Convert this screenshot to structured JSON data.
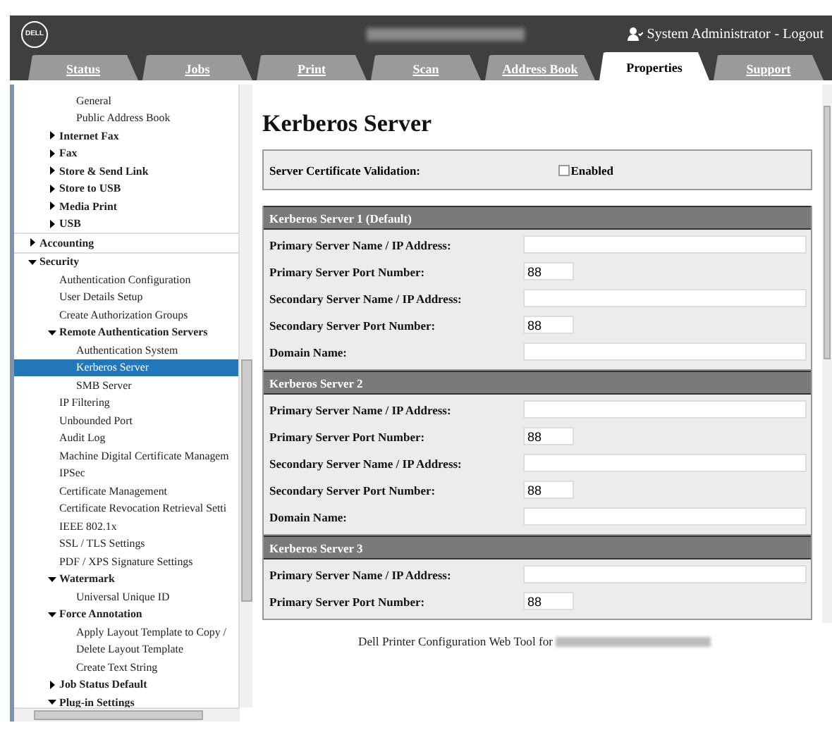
{
  "header": {
    "logo": "DELL",
    "user": "System Administrator",
    "logout": "- Logout"
  },
  "tabs": [
    {
      "label": "Status",
      "selected": false
    },
    {
      "label": "Jobs",
      "selected": false
    },
    {
      "label": "Print",
      "selected": false
    },
    {
      "label": "Scan",
      "selected": false
    },
    {
      "label": "Address Book",
      "selected": false
    },
    {
      "label": "Properties",
      "selected": true
    },
    {
      "label": "Support",
      "selected": false
    }
  ],
  "sidebar": {
    "items": [
      {
        "children": [
          {
            "children": [
              {
                "label": "General",
                "selected": false
              },
              {
                "label": "Public Address Book",
                "selected": false
              }
            ]
          },
          {
            "label": "Internet Fax",
            "expanded": false,
            "selected": false
          },
          {
            "label": "Fax",
            "expanded": false,
            "selected": false
          },
          {
            "label": "Store & Send Link",
            "expanded": false,
            "selected": false
          },
          {
            "label": "Store to USB",
            "expanded": false,
            "selected": false
          },
          {
            "label": "Media Print",
            "expanded": false,
            "selected": false
          },
          {
            "label": "USB",
            "expanded": false,
            "selected": false
          }
        ]
      },
      {
        "label": "Accounting",
        "expanded": false,
        "selected": false
      },
      {
        "label": "Security",
        "expanded": true,
        "selected": false,
        "children": [
          {
            "label": "Authentication Configuration",
            "selected": false
          },
          {
            "label": "User Details Setup",
            "selected": false
          },
          {
            "label": "Create Authorization Groups",
            "selected": false
          },
          {
            "label": "Remote Authentication Servers",
            "expanded": true,
            "selected": false,
            "children": [
              {
                "label": "Authentication System",
                "selected": false
              },
              {
                "label": "Kerberos Server",
                "selected": true
              },
              {
                "label": "SMB Server",
                "selected": false
              }
            ]
          },
          {
            "label": "IP Filtering",
            "selected": false
          },
          {
            "label": "Unbounded Port",
            "selected": false
          },
          {
            "label": "Audit Log",
            "selected": false
          },
          {
            "label": "Machine Digital Certificate Managem",
            "selected": false
          },
          {
            "label": "IPSec",
            "selected": false
          },
          {
            "label": "Certificate Management",
            "selected": false
          },
          {
            "label": "Certificate Revocation Retrieval Setti",
            "selected": false
          },
          {
            "label": "IEEE 802.1x",
            "selected": false
          },
          {
            "label": "SSL / TLS Settings",
            "selected": false
          },
          {
            "label": "PDF / XPS Signature Settings",
            "selected": false
          },
          {
            "label": "Watermark",
            "expanded": true,
            "selected": false,
            "children": [
              {
                "label": "Universal Unique ID",
                "selected": false
              }
            ]
          },
          {
            "label": "Force Annotation",
            "expanded": true,
            "selected": false,
            "children": [
              {
                "label": "Apply Layout Template to Copy /",
                "selected": false
              },
              {
                "label": "Delete Layout Template",
                "selected": false
              },
              {
                "label": "Create Text String",
                "selected": false
              }
            ]
          },
          {
            "label": "Job Status Default",
            "expanded": false,
            "selected": false
          },
          {
            "label": "Plug-in Settings",
            "expanded": true,
            "selected": false
          }
        ]
      }
    ]
  },
  "page": {
    "title": "Kerberos Server",
    "certificate_validation": {
      "label": "Server Certificate Validation:",
      "option": "Enabled",
      "checked": false
    },
    "sections": [
      {
        "title": "Kerberos Server 1 (Default)",
        "fields": [
          {
            "label": "Primary Server Name / IP Address:",
            "kind": "wide"
          },
          {
            "label": "Primary Server Port Number:",
            "kind": "short",
            "value": "88"
          },
          {
            "label": "Secondary Server Name / IP Address:",
            "kind": "wide"
          },
          {
            "label": "Secondary Server Port Number:",
            "kind": "short",
            "value": "88"
          },
          {
            "label": "Domain Name:",
            "kind": "wide"
          }
        ]
      },
      {
        "title": "Kerberos Server 2",
        "fields": [
          {
            "label": "Primary Server Name / IP Address:",
            "kind": "wide"
          },
          {
            "label": "Primary Server Port Number:",
            "kind": "short",
            "value": "88"
          },
          {
            "label": "Secondary Server Name / IP Address:",
            "kind": "wide"
          },
          {
            "label": "Secondary Server Port Number:",
            "kind": "short",
            "value": "88"
          },
          {
            "label": "Domain Name:",
            "kind": "wide"
          }
        ]
      },
      {
        "title": "Kerberos Server 3",
        "fields": [
          {
            "label": "Primary Server Name / IP Address:",
            "kind": "wide"
          },
          {
            "label": "Primary Server Port Number:",
            "kind": "short",
            "value": "88"
          }
        ]
      }
    ]
  },
  "footer": {
    "text": "Dell Printer Configuration Web Tool for"
  }
}
